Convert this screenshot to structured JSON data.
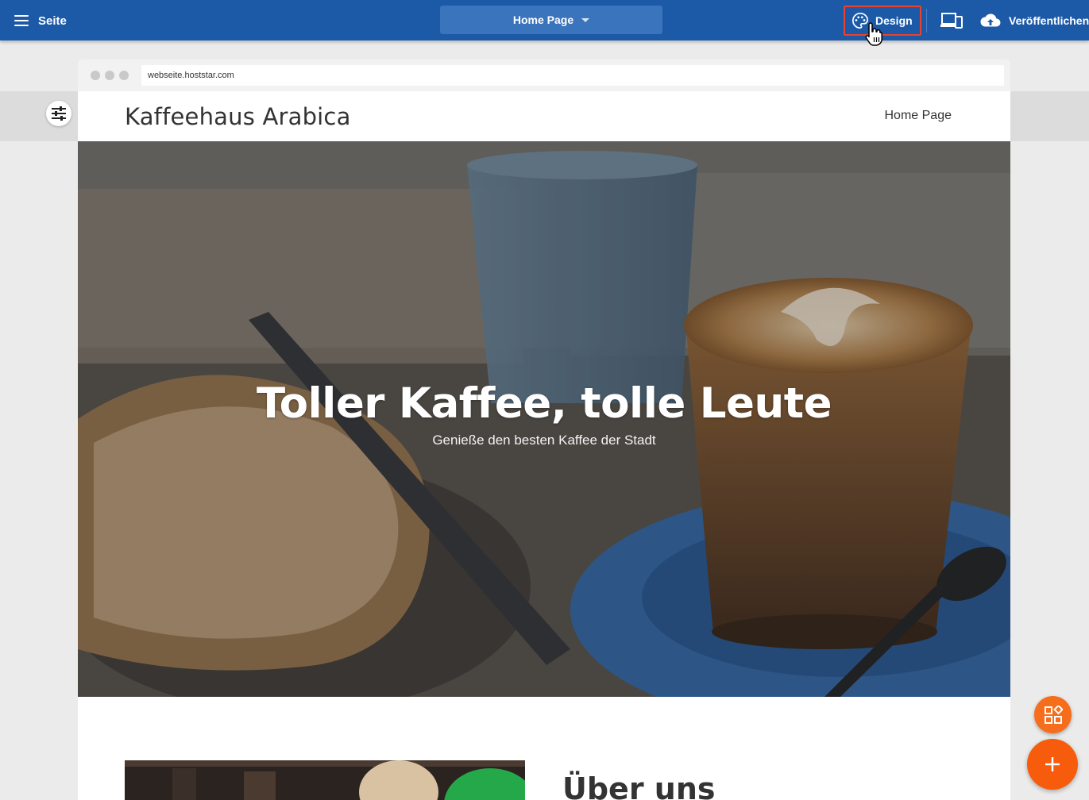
{
  "toolbar": {
    "menu_label": "Seite",
    "page_select_label": "Home Page",
    "design_label": "Design",
    "publish_label": "Veröffentlichen"
  },
  "browser": {
    "url": "webseite.hoststar.com"
  },
  "site": {
    "title": "Kaffeehaus Arabica",
    "nav_item": "Home Page",
    "hero_title": "Toller Kaffee, tolle Leute",
    "hero_subtitle": "Genieße den besten Kaffee der Stadt",
    "about_title": "Über uns"
  },
  "colors": {
    "toolbar_bg": "#1c5aa8",
    "highlight_border": "#e8432f",
    "fab_orange": "#f65c0c"
  },
  "icons": {
    "menu": "hamburger-icon",
    "design": "palette-icon",
    "device": "responsive-devices-icon",
    "publish": "cloud-upload-icon",
    "settings": "sliders-icon",
    "widgets": "widgets-icon",
    "add": "plus-icon"
  }
}
